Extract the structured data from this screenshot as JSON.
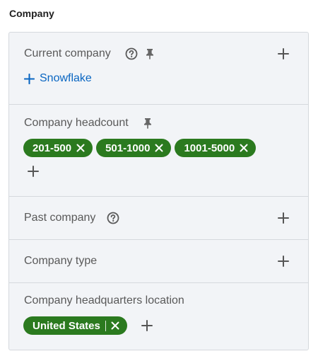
{
  "section": {
    "title": "Company"
  },
  "filters": {
    "current_company": {
      "label": "Current company",
      "add_value": "Snowflake"
    },
    "headcount": {
      "label": "Company headcount",
      "chips": [
        "201-500",
        "501-1000",
        "1001-5000"
      ]
    },
    "past_company": {
      "label": "Past company"
    },
    "company_type": {
      "label": "Company type"
    },
    "hq_location": {
      "label": "Company headquarters location",
      "chip": "United States"
    }
  },
  "icons": {
    "help": "question-circle-icon",
    "pin": "pin-icon",
    "add": "plus-icon",
    "remove": "close-icon"
  },
  "colors": {
    "chip_bg": "#2b7a1f",
    "link": "#0a66c2",
    "panel_bg": "#f2f4f7",
    "border": "#d5d9dd"
  }
}
